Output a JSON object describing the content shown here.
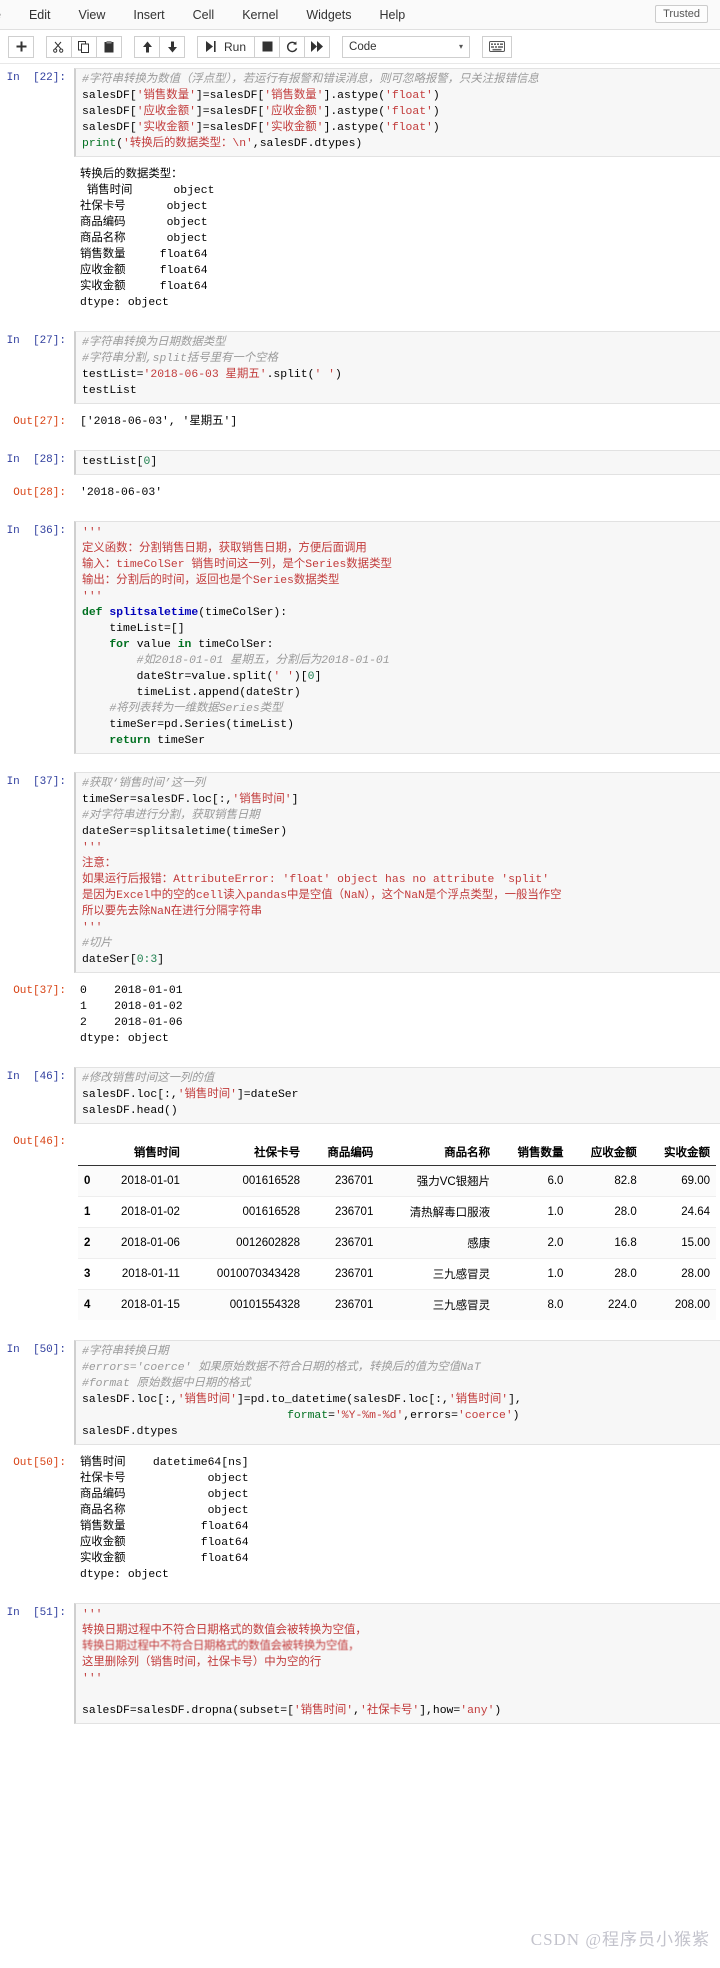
{
  "menu": {
    "items": [
      "e",
      "Edit",
      "View",
      "Insert",
      "Cell",
      "Kernel",
      "Widgets",
      "Help"
    ],
    "trusted_label": "Trusted"
  },
  "toolbar": {
    "add_label": "+",
    "cut_label": "✂",
    "copy_label": "⧉",
    "paste_label": "⎘",
    "up_label": "↑",
    "down_label": "↓",
    "run_label": "Run",
    "stop_label": "■",
    "restart_label": "↻",
    "restart_run_all_label": "➤➤",
    "celltype_value": "Code",
    "celltype_caret": "▾",
    "keyboard_label": "⌨"
  },
  "cells": [
    {
      "in_prompt": "In  [22]:",
      "code_lines": [
        "#字符串转换为数值（浮点型），若运行有报警和错误消息，则可忽略报警，只关注报错信息",
        "salesDF['销售数量']=salesDF['销售数量'].astype('float')",
        "salesDF['应收金额']=salesDF['应收金额'].astype('float')",
        "salesDF['实收金额']=salesDF['实收金额'].astype('float')",
        "print('转换后的数据类型：\\n',salesDF.dtypes)"
      ],
      "stdout_lines": [
        "转换后的数据类型：",
        " 销售时间      object",
        "社保卡号      object",
        "商品编码      object",
        "商品名称      object",
        "销售数量     float64",
        "应收金额     float64",
        "实收金额     float64",
        "dtype: object"
      ]
    },
    {
      "in_prompt": "In  [27]:",
      "code_lines": [
        "#字符串转换为日期数据类型",
        "#字符串分割,split括号里有一个空格",
        "testList='2018-06-03 星期五'.split(' ')",
        "testList"
      ],
      "out_prompt": "Out[27]:",
      "out_lines": [
        "['2018-06-03', '星期五']"
      ]
    },
    {
      "in_prompt": "In  [28]:",
      "code_lines": [
        "testList[0]"
      ],
      "out_prompt": "Out[28]:",
      "out_lines": [
        "'2018-06-03'"
      ]
    },
    {
      "in_prompt": "In  [36]:",
      "code_lines": [
        "'''",
        "定义函数：分割销售日期，获取销售日期，方便后面调用",
        "输入：timeColSer 销售时间这一列，是个Series数据类型",
        "输出：分割后的时间，返回也是个Series数据类型",
        "'''",
        "def splitsaletime(timeColSer):",
        "    timeList=[]",
        "    for value in timeColSer:",
        "        #如2018-01-01 星期五，分割后为2018-01-01",
        "        dateStr=value.split(' ')[0]",
        "        timeList.append(dateStr)",
        "    #将列表转为一维数据Series类型",
        "    timeSer=pd.Series(timeList)",
        "    return timeSer"
      ]
    },
    {
      "in_prompt": "In  [37]:",
      "code_lines": [
        "#获取‘销售时间’这一列",
        "timeSer=salesDF.loc[:,'销售时间']",
        "#对字符串进行分割，获取销售日期",
        "dateSer=splitsaletime(timeSer)",
        "'''",
        "注意：",
        "如果运行后报错：AttributeError: 'float' object has no attribute 'split'",
        "是因为Excel中的空的cell读入pandas中是空值（NaN），这个NaN是个浮点类型，一般当作空",
        "所以要先去除NaN在进行分隔字符串",
        "'''",
        "#切片",
        "dateSer[0:3]"
      ],
      "out_prompt": "Out[37]:",
      "out_lines": [
        "0    2018-01-01",
        "1    2018-01-02",
        "2    2018-01-06",
        "dtype: object"
      ]
    },
    {
      "in_prompt": "In  [46]:",
      "code_lines": [
        "#修改销售时间这一列的值",
        "salesDF.loc[:,'销售时间']=dateSer",
        "salesDF.head()"
      ],
      "out_prompt": "Out[46]:",
      "table": {
        "index_header": "",
        "columns": [
          "销售时间",
          "社保卡号",
          "商品编码",
          "商品名称",
          "销售数量",
          "应收金额",
          "实收金额"
        ],
        "rows": [
          {
            "index": "0",
            "cells": [
              "2018-01-01",
              "001616528",
              "236701",
              "强力VC银翘片",
              "6.0",
              "82.8",
              "69.00"
            ]
          },
          {
            "index": "1",
            "cells": [
              "2018-01-02",
              "001616528",
              "236701",
              "清热解毒口服液",
              "1.0",
              "28.0",
              "24.64"
            ]
          },
          {
            "index": "2",
            "cells": [
              "2018-01-06",
              "0012602828",
              "236701",
              "感康",
              "2.0",
              "16.8",
              "15.00"
            ]
          },
          {
            "index": "3",
            "cells": [
              "2018-01-11",
              "0010070343428",
              "236701",
              "三九感冒灵",
              "1.0",
              "28.0",
              "28.00"
            ]
          },
          {
            "index": "4",
            "cells": [
              "2018-01-15",
              "00101554328",
              "236701",
              "三九感冒灵",
              "8.0",
              "224.0",
              "208.00"
            ]
          }
        ]
      }
    },
    {
      "in_prompt": "In  [50]:",
      "code_lines": [
        "#字符串转换日期",
        "#errors='coerce' 如果原始数据不符合日期的格式，转换后的值为空值NaT",
        "#format 原始数据中日期的格式",
        "salesDF.loc[:,'销售时间']=pd.to_datetime(salesDF.loc[:,'销售时间'],",
        "                              format='%Y-%m-%d',errors='coerce')",
        "salesDF.dtypes"
      ],
      "out_prompt": "Out[50]:",
      "out_lines": [
        "销售时间    datetime64[ns]",
        "社保卡号            object",
        "商品编码            object",
        "商品名称            object",
        "销售数量           float64",
        "应收金额           float64",
        "实收金额           float64",
        "dtype: object"
      ]
    },
    {
      "in_prompt": "In  [51]:",
      "code_lines": [
        "'''",
        "转换日期过程中不符合日期格式的数值会被转换为空值，",
        "这里删除列（销售时间，社保卡号）中为空的行",
        "'''",
        "salesDF=salesDF.dropna(subset=['销售时间','社保卡号'],how='any')"
      ]
    }
  ],
  "watermark": "CSDN @程序员小猴紫"
}
